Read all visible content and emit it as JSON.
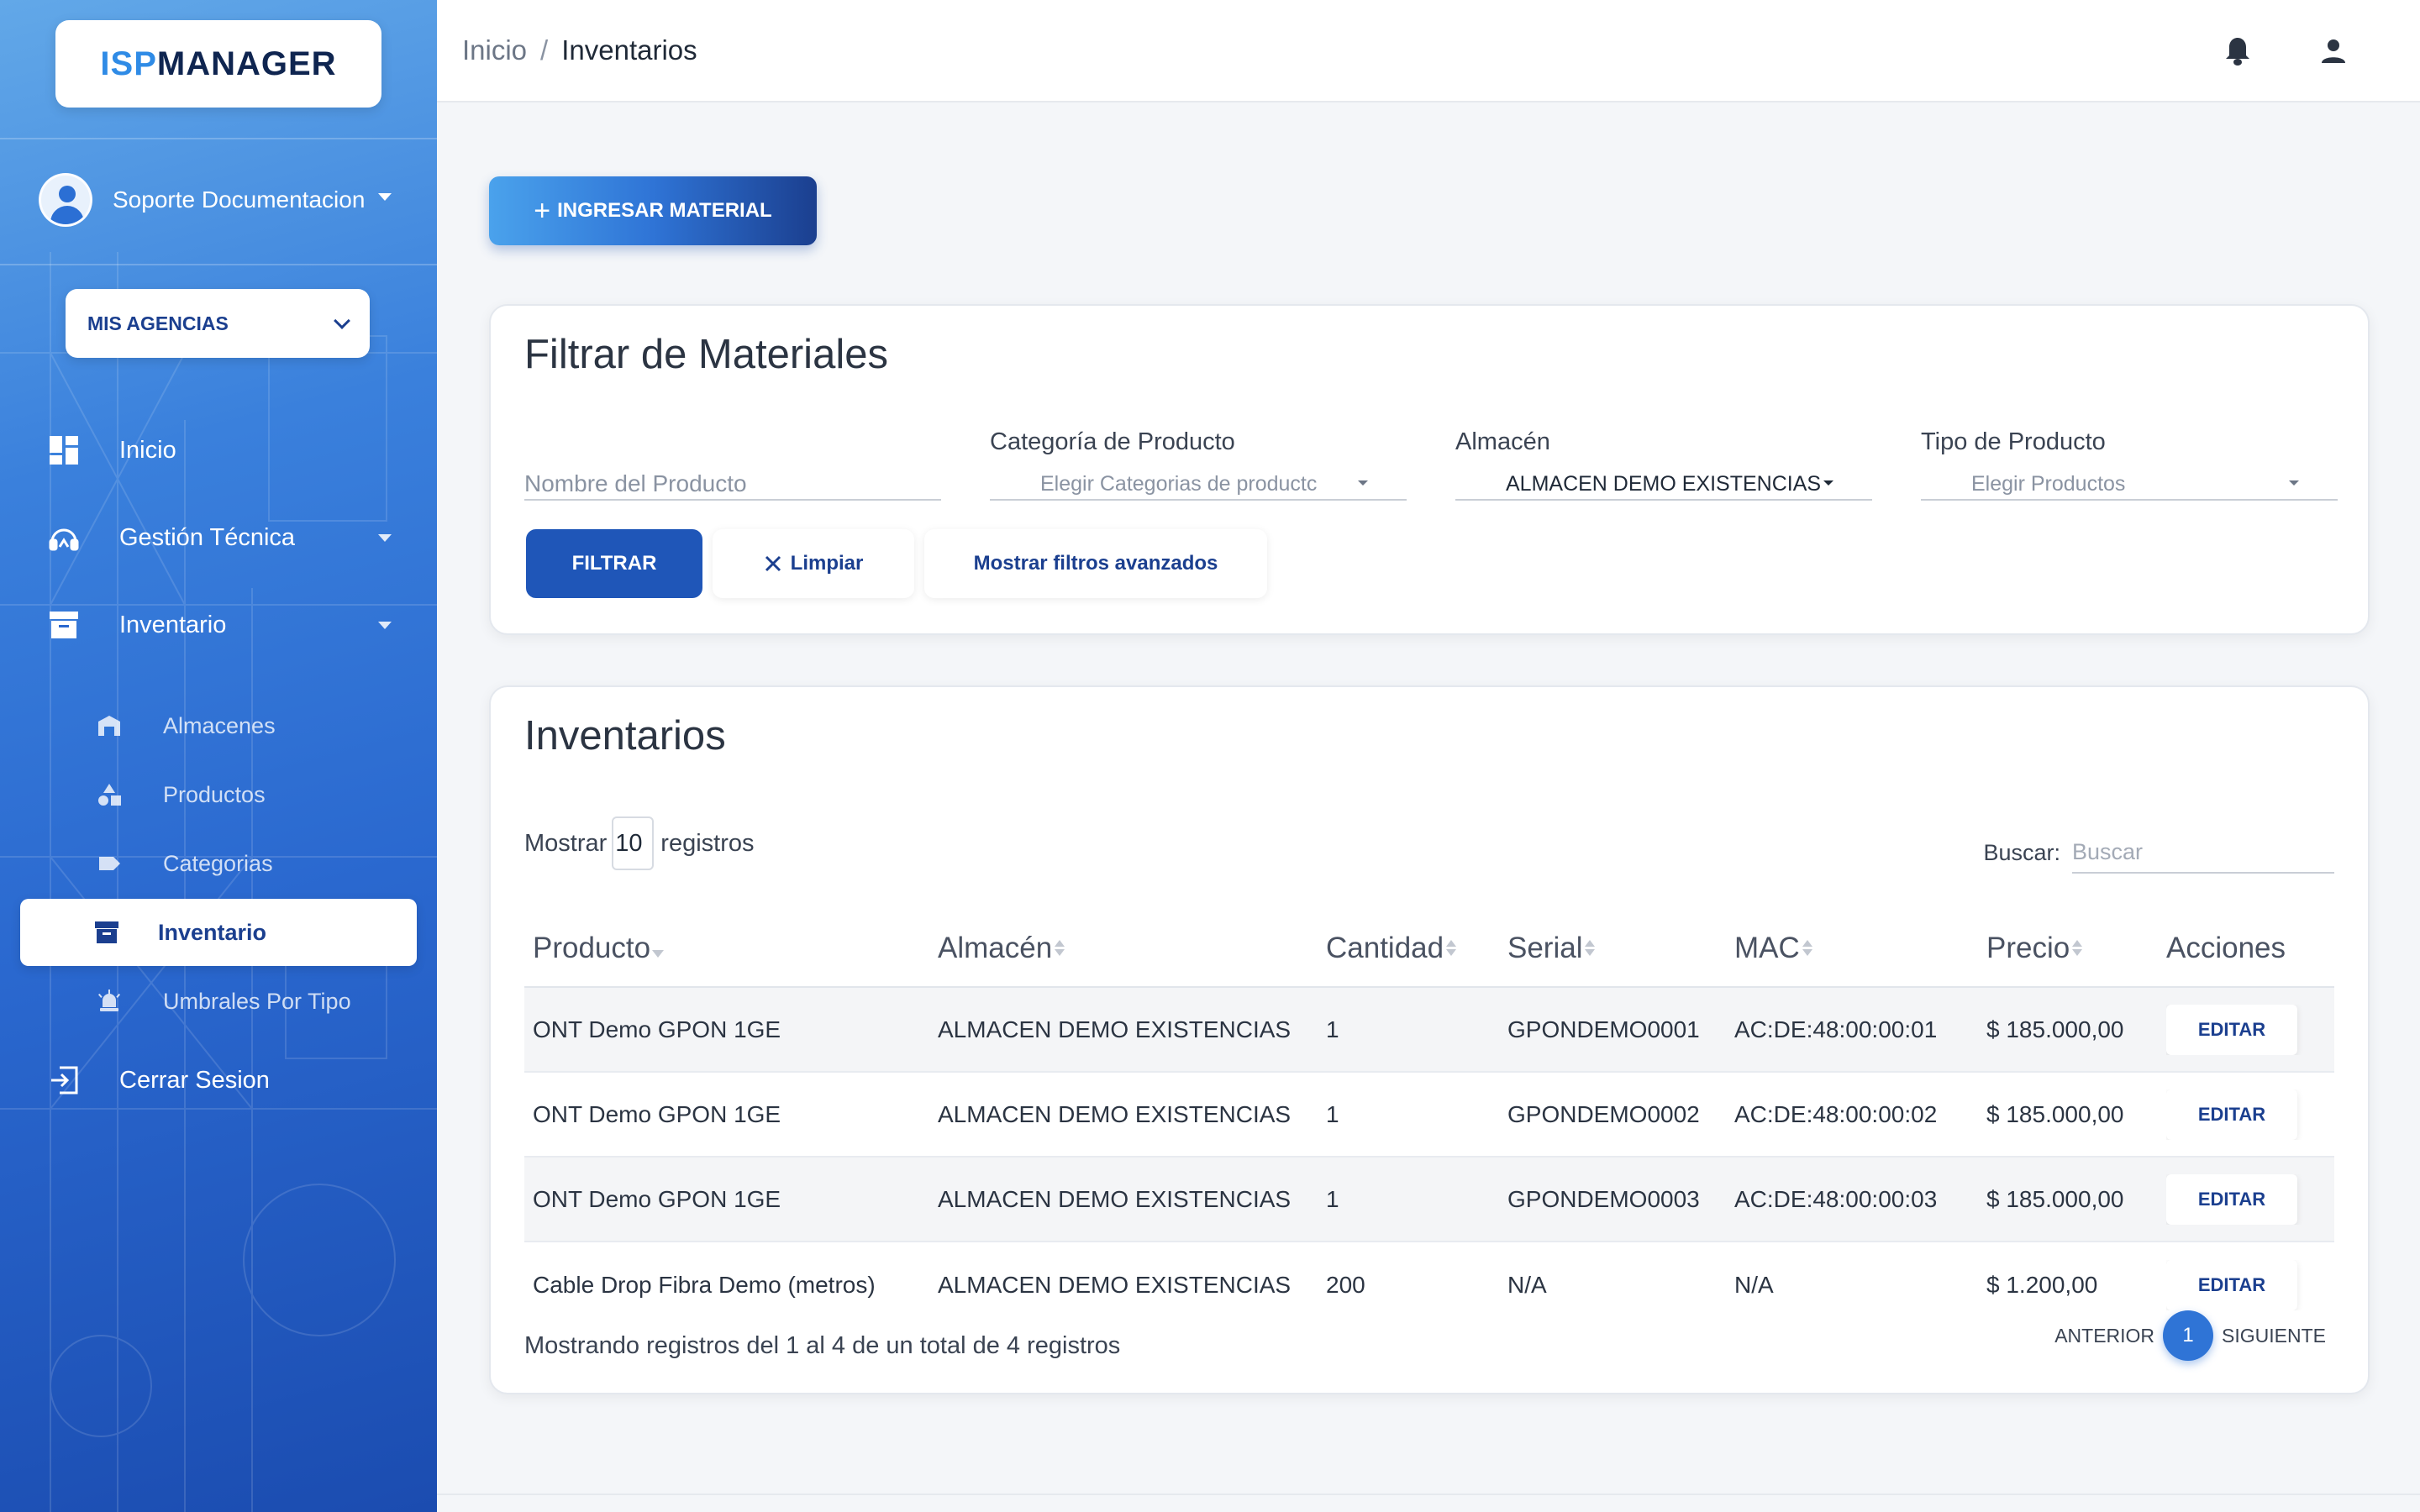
{
  "brand": {
    "part1": "ISP",
    "part2": "MANAGER"
  },
  "user": {
    "name": "Soporte Documentacion"
  },
  "agencias": {
    "label": "MIS AGENCIAS"
  },
  "nav": {
    "inicio": "Inicio",
    "gestion": "Gestión Técnica",
    "inventario": "Inventario",
    "sub": {
      "almacenes": "Almacenes",
      "productos": "Productos",
      "categorias": "Categorias",
      "inventario": "Inventario",
      "umbrales": "Umbrales Por Tipo"
    },
    "cerrar": "Cerrar Sesion"
  },
  "breadcrumb": {
    "home": "Inicio",
    "sep": "/",
    "current": "Inventarios"
  },
  "actions": {
    "ingresar": "INGRESAR MATERIAL"
  },
  "filter": {
    "title": "Filtrar de Materiales",
    "nombre_placeholder": "Nombre del Producto",
    "categoria_label": "Categoría de Producto",
    "categoria_value": "Elegir Categorias de productc",
    "almacen_label": "Almacén",
    "almacen_value": "ALMACEN DEMO EXISTENCIAS",
    "tipo_label": "Tipo de Producto",
    "tipo_value": "Elegir Productos",
    "btn_filtrar": "FILTRAR",
    "btn_limpiar": "Limpiar",
    "btn_avanzados": "Mostrar filtros avanzados"
  },
  "inventory": {
    "title": "Inventarios",
    "mostrar_prefix": "Mostrar",
    "page_size": "10",
    "mostrar_suffix": "registros",
    "buscar_label": "Buscar:",
    "buscar_placeholder": "Buscar",
    "columns": [
      "Producto",
      "Almacén",
      "Cantidad",
      "Serial",
      "MAC",
      "Precio",
      "Acciones"
    ],
    "rows": [
      {
        "producto": "ONT Demo GPON 1GE",
        "almacen": "ALMACEN DEMO EXISTENCIAS",
        "cantidad": "1",
        "serial": "GPONDEMO0001",
        "mac": "AC:DE:48:00:00:01",
        "precio": "$ 185.000,00",
        "accion": "EDITAR"
      },
      {
        "producto": "ONT Demo GPON 1GE",
        "almacen": "ALMACEN DEMO EXISTENCIAS",
        "cantidad": "1",
        "serial": "GPONDEMO0002",
        "mac": "AC:DE:48:00:00:02",
        "precio": "$ 185.000,00",
        "accion": "EDITAR"
      },
      {
        "producto": "ONT Demo GPON 1GE",
        "almacen": "ALMACEN DEMO EXISTENCIAS",
        "cantidad": "1",
        "serial": "GPONDEMO0003",
        "mac": "AC:DE:48:00:00:03",
        "precio": "$ 185.000,00",
        "accion": "EDITAR"
      },
      {
        "producto": "Cable Drop Fibra Demo (metros)",
        "almacen": "ALMACEN DEMO EXISTENCIAS",
        "cantidad": "200",
        "serial": "N/A",
        "mac": "N/A",
        "precio": "$ 1.200,00",
        "accion": "EDITAR"
      }
    ],
    "footer_info": "Mostrando registros del 1 al 4 de un total de 4 registros",
    "pager": {
      "prev": "ANTERIOR",
      "page": "1",
      "next": "SIGUIENTE"
    }
  },
  "colors": {
    "primary": "#1f56b8",
    "dark_blue": "#1b3f8f",
    "accent": "#2f74d6"
  }
}
